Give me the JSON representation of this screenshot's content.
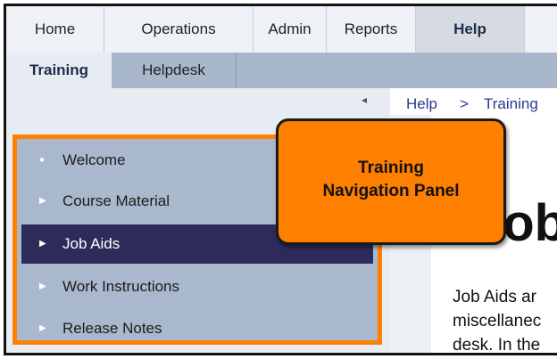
{
  "top_nav": {
    "items": [
      {
        "label": "Home",
        "active": false
      },
      {
        "label": "Operations",
        "active": false
      },
      {
        "label": "Admin",
        "active": false
      },
      {
        "label": "Reports",
        "active": false
      },
      {
        "label": "Help",
        "active": true
      }
    ]
  },
  "sub_nav": {
    "items": [
      {
        "label": "Training",
        "active": true
      },
      {
        "label": "Helpdesk",
        "active": false
      }
    ]
  },
  "breadcrumb": {
    "items": [
      "Help",
      "Training"
    ],
    "separator": ">"
  },
  "nav_panel": {
    "items": [
      {
        "label": "Welcome",
        "icon": "dot-bullet-icon",
        "selected": false
      },
      {
        "label": "Course Material",
        "icon": "triangle-bullet-icon",
        "selected": false
      },
      {
        "label": "Job Aids",
        "icon": "triangle-bullet-icon",
        "selected": true
      },
      {
        "label": "Work Instructions",
        "icon": "triangle-bullet-icon",
        "selected": false
      },
      {
        "label": "Release Notes",
        "icon": "triangle-bullet-icon",
        "selected": false
      }
    ]
  },
  "callout": {
    "line1": "Training",
    "line2": "Navigation Panel"
  },
  "content": {
    "title": "Job",
    "body_lines": [
      "Job Aids ar",
      "miscellanec",
      "desk. In the"
    ]
  },
  "colors": {
    "highlight": "#ff7f00",
    "selected_item": "#2e2b5a",
    "sub_nav_bg": "#a9b7cd"
  }
}
